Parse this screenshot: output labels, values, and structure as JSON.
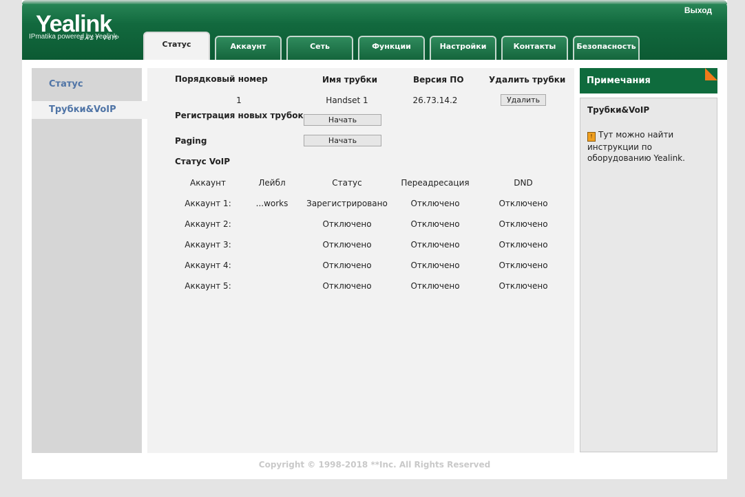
{
  "header": {
    "logo": "Yealink",
    "logo_tagline": "EASY VoIP",
    "powered_by": "IPmatika powered by Yealink",
    "logout": "Выход"
  },
  "tabs": [
    {
      "label": "Статус",
      "active": true
    },
    {
      "label": "Аккаунт"
    },
    {
      "label": "Сеть"
    },
    {
      "label": "Функции"
    },
    {
      "label": "Настройки"
    },
    {
      "label": "Контакты"
    },
    {
      "label": "Безопасность"
    }
  ],
  "sidebar": {
    "items": [
      {
        "label": "Статус"
      },
      {
        "label": "Трубки&VoIP",
        "active": true
      }
    ]
  },
  "handsets": {
    "headers": [
      "Порядковый номер",
      "Имя трубки",
      "Версия ПО",
      "Удалить трубки"
    ],
    "rows": [
      {
        "index": "1",
        "name": "Handset 1",
        "version": "26.73.14.2",
        "delete_label": "Удалить"
      }
    ],
    "registration_label": "Регистрация новых трубок",
    "registration_button": "Начать",
    "paging_label": "Paging",
    "paging_button": "Начать"
  },
  "voip": {
    "title": "Статус VoIP",
    "headers": [
      "Аккаунт",
      "Лейбл",
      "Статус",
      "Переадресация",
      "DND"
    ],
    "rows": [
      {
        "account": "Аккаунт 1:",
        "label": "...works",
        "status": "Зарегистрировано",
        "forward": "Отключено",
        "dnd": "Отключено"
      },
      {
        "account": "Аккаунт 2:",
        "label": "",
        "status": "Отключено",
        "forward": "Отключено",
        "dnd": "Отключено"
      },
      {
        "account": "Аккаунт 3:",
        "label": "",
        "status": "Отключено",
        "forward": "Отключено",
        "dnd": "Отключено"
      },
      {
        "account": "Аккаунт 4:",
        "label": "",
        "status": "Отключено",
        "forward": "Отключено",
        "dnd": "Отключено"
      },
      {
        "account": "Аккаунт 5:",
        "label": "",
        "status": "Отключено",
        "forward": "Отключено",
        "dnd": "Отключено"
      }
    ]
  },
  "notes": {
    "header": "Примечания",
    "title": "Трубки&VoIP",
    "text": "Тут можно найти инструкции по оборудованию Yealink.",
    "icon": "info-icon"
  },
  "footer": {
    "copyright": "Copyright © 1998-2018 **Inc. All Rights Reserved"
  },
  "colors": {
    "header_green": "#0c5a33",
    "nav_link": "#4f74a6",
    "notes_accent": "#f07a1a"
  }
}
